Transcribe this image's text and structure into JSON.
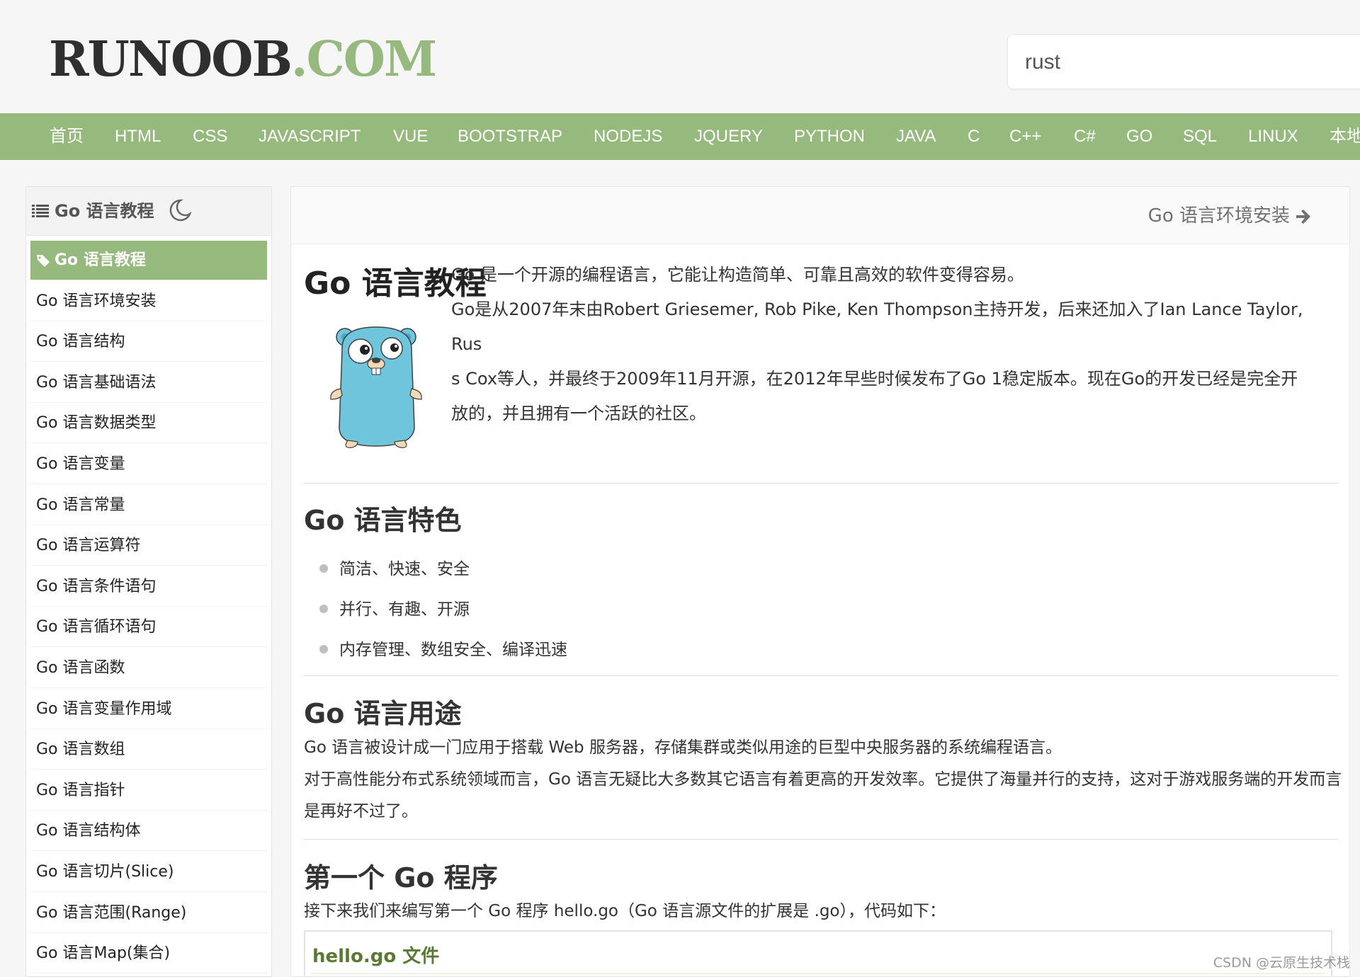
{
  "header": {
    "logo_main": "RUNOOB",
    "logo_dot": ".",
    "logo_com": "COM",
    "search_value": "rust"
  },
  "nav": {
    "items": [
      "首页",
      "HTML",
      "CSS",
      "JAVASCRIPT",
      "VUE",
      "BOOTSTRAP",
      "NODEJS",
      "JQUERY",
      "PYTHON",
      "JAVA",
      "C",
      "C++",
      "C#",
      "GO",
      "SQL",
      "LINUX",
      "本地"
    ]
  },
  "sidebar": {
    "title": "Go 语言教程",
    "items": [
      "Go 语言教程",
      "Go 语言环境安装",
      "Go 语言结构",
      "Go 语言基础语法",
      "Go 语言数据类型",
      "Go 语言变量",
      "Go 语言常量",
      "Go 语言运算符",
      "Go 语言条件语句",
      "Go 语言循环语句",
      "Go 语言函数",
      "Go 语言变量作用域",
      "Go 语言数组",
      "Go 语言指针",
      "Go 语言结构体",
      "Go 语言切片(Slice)",
      "Go 语言范围(Range)",
      "Go 语言Map(集合)"
    ],
    "active_index": 0
  },
  "main": {
    "next_link": "Go 语言环境安装",
    "title": "Go 语言教程",
    "intro": [
      "Go 是一个开源的编程语言，它能让构造简单、可靠且高效的软件变得容易。",
      "Go是从2007年末由Robert Griesemer, Rob Pike, Ken Thompson主持开发，后来还加入了Ian Lance Taylor, Rus",
      "s Cox等人，并最终于2009年11月开源，在2012年早些时候发布了Go 1稳定版本。现在Go的开发已经是完全开",
      "放的，并且拥有一个活跃的社区。"
    ],
    "features_heading": "Go 语言特色",
    "features": [
      "简洁、快速、安全",
      "并行、有趣、开源",
      "内存管理、数组安全、编译迅速"
    ],
    "usage_heading": "Go 语言用途",
    "usage": [
      "Go 语言被设计成一门应用于搭载 Web 服务器，存储集群或类似用途的巨型中央服务器的系统编程语言。",
      "对于高性能分布式系统领域而言，Go 语言无疑比大多数其它语言有着更高的开发效率。它提供了海量并行的支持，这对于游戏服务端的开发而言",
      "是再好不过了。"
    ],
    "first_heading": "第一个 Go 程序",
    "first_intro": "接下来我们来编写第一个 Go 程序 hello.go（Go 语言源文件的扩展是 .go），代码如下：",
    "code_title": "hello.go 文件"
  },
  "watermark": "CSDN @云原生技术栈",
  "colors": {
    "accent": "#96b97d",
    "logo_dark": "#2f2f2f"
  }
}
